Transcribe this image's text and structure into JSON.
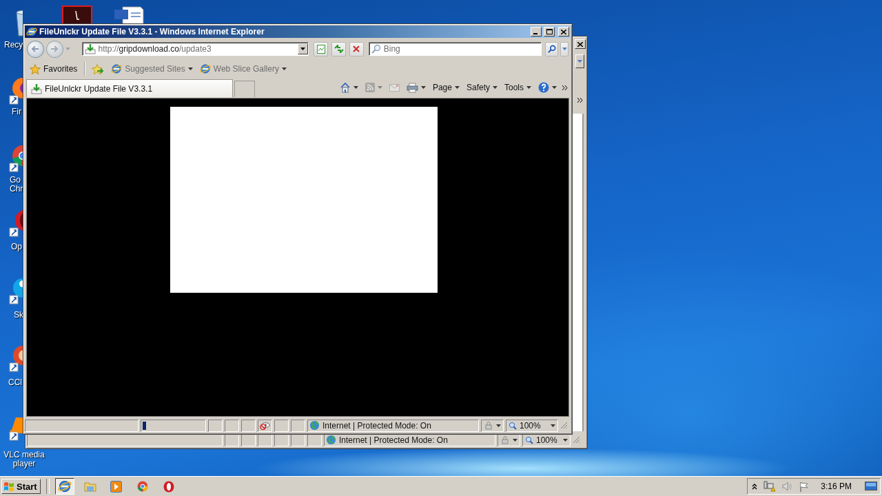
{
  "desktop_icons": [
    {
      "kind": "recycle",
      "label": "Recy",
      "shortcut": false
    },
    {
      "kind": "pdf",
      "shortcut": false
    },
    {
      "kind": "word",
      "shortcut": false
    },
    {
      "kind": "firefox",
      "label": "Fir",
      "shortcut": true
    },
    {
      "kind": "chrome",
      "label": "Go Chr",
      "shortcut": true
    },
    {
      "kind": "opera",
      "label": "Op",
      "shortcut": true
    },
    {
      "kind": "skype",
      "label": "Sk",
      "shortcut": true
    },
    {
      "kind": "ccleaner",
      "label": "CCl",
      "shortcut": true
    },
    {
      "kind": "vlc",
      "label": "VLC media player",
      "shortcut": true
    }
  ],
  "background_window": {
    "status_bar": {
      "zone": "Internet | Protected Mode: On",
      "zoom": "100%"
    }
  },
  "browser": {
    "title": "FileUnlckr Update File V3.3.1 - Windows Internet Explorer",
    "address": {
      "scheme": "http://",
      "domain": "gripdownload.co",
      "path": "/update3"
    },
    "search": {
      "placeholder": "Bing"
    },
    "favorites_bar": {
      "label": "Favorites",
      "links": [
        {
          "label": "Suggested Sites"
        },
        {
          "label": "Web Slice Gallery"
        }
      ]
    },
    "tabs": [
      {
        "label": "FileUnlckr Update File V3.3.1",
        "selected": true
      }
    ],
    "command_bar": [
      {
        "kind": "home",
        "disabled": false
      },
      {
        "kind": "feeds",
        "disabled": true
      },
      {
        "kind": "mail",
        "disabled": true
      },
      {
        "kind": "print",
        "disabled": false
      },
      {
        "kind": "menu",
        "label": "Page",
        "disabled": false
      },
      {
        "kind": "menu",
        "label": "Safety",
        "disabled": false
      },
      {
        "kind": "menu",
        "label": "Tools",
        "disabled": false
      },
      {
        "kind": "help",
        "disabled": false
      }
    ],
    "status_bar": {
      "progress": {
        "level": 0.06
      },
      "zone": "Internet | Protected Mode: On",
      "zoom": "100%"
    }
  },
  "taskbar": {
    "start": "Start",
    "items": [
      {
        "kind": "ie",
        "selected": true
      },
      {
        "kind": "folder",
        "selected": false
      },
      {
        "kind": "media",
        "selected": false
      },
      {
        "kind": "chrome",
        "selected": false
      },
      {
        "kind": "opera",
        "selected": false
      }
    ],
    "clock": "3:16 PM"
  }
}
